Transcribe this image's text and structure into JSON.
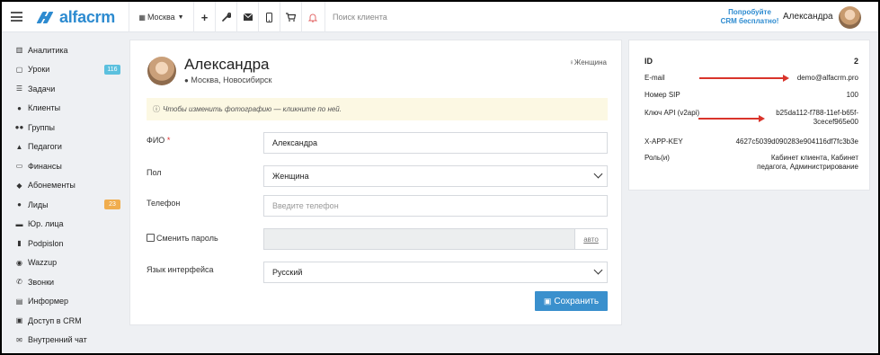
{
  "topbar": {
    "logo_text": "alfacrm",
    "city": "Москва",
    "search_placeholder": "Поиск клиента",
    "try_line1": "Попробуйте",
    "try_line2": "CRM бесплатно!",
    "user_name": "Александра",
    "icons": [
      "menu-icon",
      "building-icon",
      "plus-icon",
      "wrench-icon",
      "mail-icon",
      "phone-icon",
      "cart-icon",
      "bell-icon"
    ]
  },
  "sidebar": {
    "items": [
      {
        "label": "Аналитика",
        "icon": "chart-icon",
        "glyph": "▥"
      },
      {
        "label": "Уроки",
        "icon": "calendar-icon",
        "glyph": "▢",
        "badge": "116",
        "badge_color": "#5bc0de"
      },
      {
        "label": "Задачи",
        "icon": "tasks-icon",
        "glyph": "☰"
      },
      {
        "label": "Клиенты",
        "icon": "user-icon",
        "glyph": "●"
      },
      {
        "label": "Группы",
        "icon": "users-icon",
        "glyph": "●●"
      },
      {
        "label": "Педагоги",
        "icon": "graduation-icon",
        "glyph": "▲"
      },
      {
        "label": "Финансы",
        "icon": "money-icon",
        "glyph": "▭"
      },
      {
        "label": "Абонементы",
        "icon": "tag-icon",
        "glyph": "◆"
      },
      {
        "label": "Лиды",
        "icon": "user-plus-icon",
        "glyph": "●",
        "badge": "23",
        "badge_color": "#f0ad4e"
      },
      {
        "label": "Юр. лица",
        "icon": "briefcase-icon",
        "glyph": "▬"
      },
      {
        "label": "Podpislon",
        "icon": "file-icon",
        "glyph": "▮"
      },
      {
        "label": "Wazzup",
        "icon": "whatsapp-icon",
        "glyph": "◉"
      },
      {
        "label": "Звонки",
        "icon": "phone-icon",
        "glyph": "✆"
      },
      {
        "label": "Информер",
        "icon": "book-icon",
        "glyph": "▤"
      },
      {
        "label": "Доступ в CRM",
        "icon": "lock-icon",
        "glyph": "▣"
      },
      {
        "label": "Внутренний чат",
        "icon": "envelope-icon",
        "glyph": "✉"
      }
    ]
  },
  "profile": {
    "name": "Александра",
    "city": "Москва, Новосибирск",
    "gender_label": "Женщина",
    "notice": "Чтобы изменить фотографию — кликните по ней."
  },
  "form": {
    "fio_label": "ФИО",
    "fio_value": "Александра",
    "gender_label": "Пол",
    "gender_value": "Женщина",
    "phone_label": "Телефон",
    "phone_placeholder": "Введите телефон",
    "password_label": "Сменить пароль",
    "auto_label": "авто",
    "lang_label": "Язык интерфейса",
    "lang_value": "Русский",
    "save_label": "Сохранить"
  },
  "info": {
    "rows": [
      {
        "key": "ID",
        "value": "2"
      },
      {
        "key": "E-mail",
        "value": "demo@alfacrm.pro"
      },
      {
        "key": "Номер SIP",
        "value": "100"
      },
      {
        "key": "Ключ API (v2api)",
        "value": "b25da112-f788-11ef-b65f-\n3cecef965e00"
      },
      {
        "key": "X-APP-KEY",
        "value": "4627c5039d090283e904116df7fc3b3e"
      },
      {
        "key": "Роль(и)",
        "value": "Кабинет клиента, Кабинет\nпедагога, Администрирование"
      }
    ],
    "accent": "#d9342b"
  }
}
